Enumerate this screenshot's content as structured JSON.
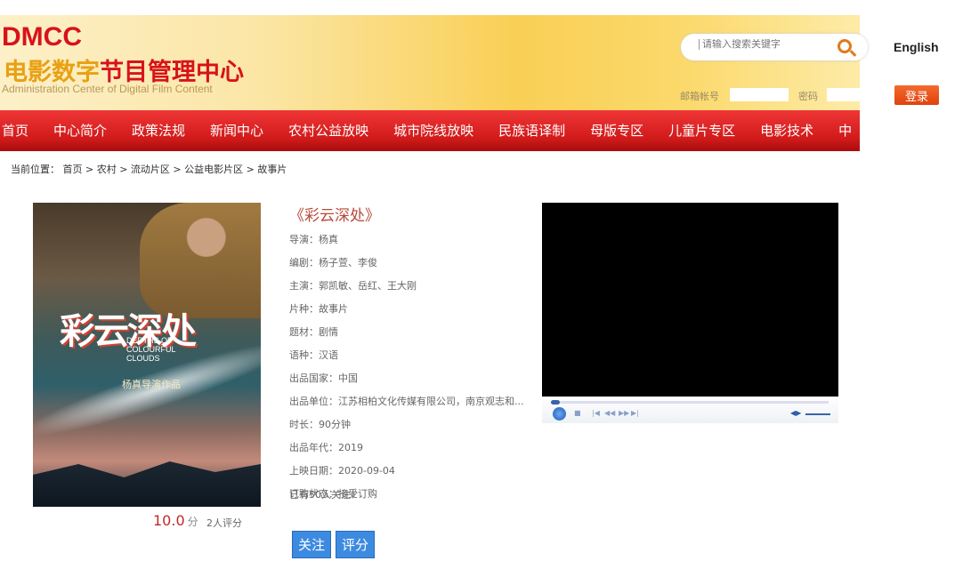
{
  "header": {
    "logo_en": "DMCC",
    "logo_cn_a": "电影数字",
    "logo_cn_b": "节目管理中心",
    "logo_sub": "Administration Center of Digital Film Content",
    "search_placeholder": "请输入搜索关键字",
    "email_label": "邮箱帐号",
    "password_label": "密码",
    "english": "English",
    "login": "登录"
  },
  "nav": [
    "首页",
    "中心简介",
    "政策法规",
    "新闻中心",
    "农村公益放映",
    "城市院线放映",
    "民族语译制",
    "母版专区",
    "儿童片专区",
    "电影技术",
    "中"
  ],
  "breadcrumb": "当前位置： 首页 > 农村 > 流动片区 > 公益电影片区 > 故事片",
  "poster": {
    "title": "彩云深处",
    "en_title": "DEPTHS OF COLOURFUL CLOUDS",
    "credit": "杨真导演作品"
  },
  "rating": {
    "score": "10.0",
    "unit": "分",
    "count": "2人评分"
  },
  "movie": {
    "title": "《彩云深处》",
    "fields": [
      "导演：杨真",
      "编剧：杨子萱、李俊",
      "主演：郭凯敏、岳红、王大刚",
      "片种：故事片",
      "题材：剧情",
      "语种：汉语",
      "出品国家：中国",
      "出品单位：江苏相柏文化传媒有限公司，南京观志和...",
      "时长：90分钟",
      "出品年代：2019",
      "上映日期：2020-09-04",
      "订购状态：接受订购"
    ],
    "followers": "已有50人关注！",
    "follow_btn": "关注",
    "rate_btn": "评分"
  },
  "colors": {
    "nav": "#d11a1a",
    "accent": "#c0282a",
    "button": "#3d8be0"
  }
}
